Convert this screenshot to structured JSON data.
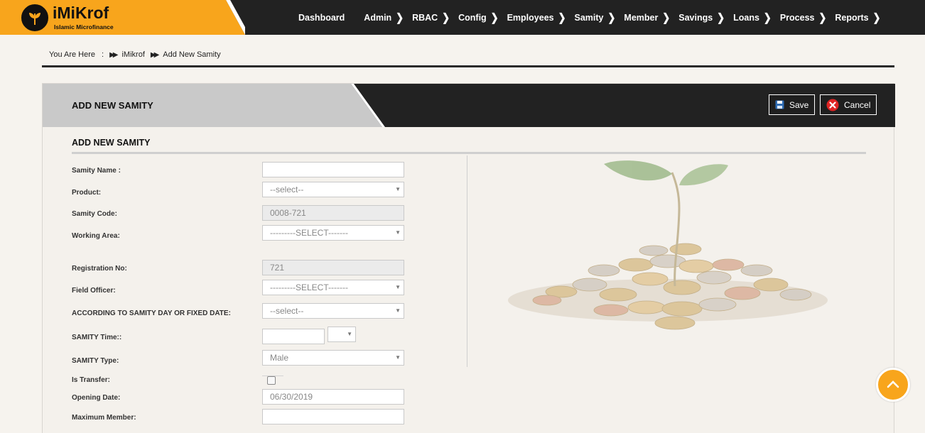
{
  "brand": {
    "name": "iMiKrof",
    "tagline": "Islamic Microfinance",
    "accent": "#f8a51c"
  },
  "nav": [
    {
      "label": "Dashboard",
      "has_chevron": false
    },
    {
      "label": "Admin",
      "has_chevron": true
    },
    {
      "label": "RBAC",
      "has_chevron": true
    },
    {
      "label": "Config",
      "has_chevron": true
    },
    {
      "label": "Employees",
      "has_chevron": true
    },
    {
      "label": "Samity",
      "has_chevron": true
    },
    {
      "label": "Member",
      "has_chevron": true
    },
    {
      "label": "Savings",
      "has_chevron": true
    },
    {
      "label": "Loans",
      "has_chevron": true
    },
    {
      "label": "Process",
      "has_chevron": true
    },
    {
      "label": "Reports",
      "has_chevron": true
    }
  ],
  "breadcrumb": {
    "prefix": "You Are Here",
    "colon": ":",
    "items": [
      "iMikrof",
      "Add New Samity"
    ]
  },
  "panel": {
    "title": "ADD NEW SAMITY",
    "save_label": "Save",
    "cancel_label": "Cancel",
    "section_title": "ADD NEW SAMITY"
  },
  "form": {
    "samity_name": {
      "label": "Samity Name :",
      "value": ""
    },
    "product": {
      "label": "Product:",
      "value": "--select--"
    },
    "samity_code": {
      "label": "Samity Code:",
      "value": "0008-721"
    },
    "working_area": {
      "label": "Working Area:",
      "value": "---------SELECT-------"
    },
    "registration_no": {
      "label": "Registration No:",
      "value": "721"
    },
    "field_officer": {
      "label": "Field Officer:",
      "value": "---------SELECT-------"
    },
    "samity_day": {
      "label": "ACCORDING TO SAMITY DAY OR FIXED DATE:",
      "value": "--select--"
    },
    "samity_time": {
      "label": "SAMITY Time::",
      "value": "",
      "period": ""
    },
    "samity_type": {
      "label": "SAMITY Type:",
      "value": "Male"
    },
    "is_transfer": {
      "label": "Is Transfer:",
      "checked": false
    },
    "opening_date": {
      "label": "Opening Date:",
      "value": "06/30/2019"
    },
    "maximum_member": {
      "label": "Maximum Member:",
      "value": ""
    }
  },
  "icons": {
    "save": "floppy-disk-icon",
    "cancel": "close-circle-icon",
    "scroll_top": "chevron-up-icon"
  }
}
